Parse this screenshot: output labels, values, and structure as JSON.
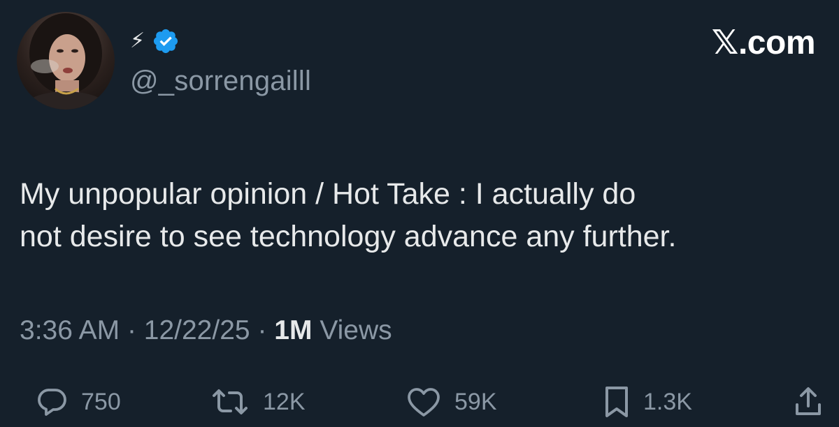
{
  "author": {
    "display_name": "⚡",
    "handle": "@_sorrengailll",
    "avatar_icon": "profile-photo",
    "verified_icon": "verified-badge-icon",
    "verified_color": "#1d9bf0"
  },
  "brand": {
    "label": "𝕏.com"
  },
  "tweet": {
    "lines": [
      "My unpopular opinion / Hot Take : I actually do",
      "not desire to see technology advance any further."
    ]
  },
  "meta": {
    "time": "3:36 AM",
    "separator": "·",
    "date": "12/22/25",
    "views_count": "1M",
    "views_label": "Views"
  },
  "actions": {
    "replies": {
      "icon": "reply-icon",
      "count": "750"
    },
    "reposts": {
      "icon": "repost-icon",
      "count": "12K"
    },
    "likes": {
      "icon": "like-icon",
      "count": "59K"
    },
    "bookmarks": {
      "icon": "bookmark-icon",
      "count": "1.3K"
    },
    "share": {
      "icon": "share-icon"
    }
  },
  "colors": {
    "background": "#15202b",
    "primary_text": "#e7e9ea",
    "secondary_text": "#8b98a5"
  }
}
